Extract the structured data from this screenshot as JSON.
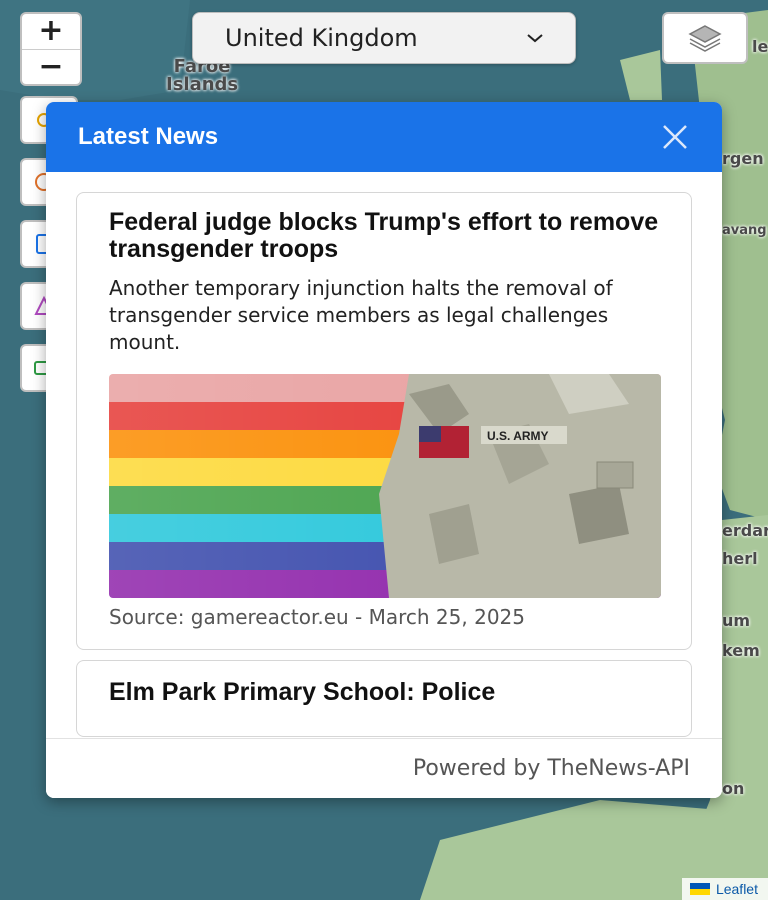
{
  "map": {
    "labels": {
      "faroe": "Faroe\nIslands",
      "edge_1": "les",
      "edge_2": "rgen",
      "edge_3": "avang",
      "edge_4": "erdar",
      "edge_5": "herl",
      "edge_6": "um",
      "edge_7": "kem",
      "edge_8": "on"
    },
    "attribution": "Leaflet"
  },
  "controls": {
    "zoom_in": "+",
    "zoom_out": "−",
    "country_select": {
      "value": "United Kingdom",
      "icon": "chevron-down-icon"
    },
    "layers_icon": "layers-icon"
  },
  "modal": {
    "title": "Latest News",
    "close_icon": "close-icon",
    "articles": [
      {
        "title": "Federal judge blocks Trump's effort to remove transgender troops",
        "description": "Another temporary injunction halts the removal of transgender service members as legal challenges mount.",
        "image_patch": "U.S. ARMY",
        "source": "Source: gamereactor.eu - March 25, 2025"
      },
      {
        "title": "Elm Park Primary School: Police"
      }
    ],
    "footer": "Powered by TheNews-API"
  },
  "colors": {
    "header_blue": "#1a73e8",
    "sea": "#3b6e7c",
    "land": "#a9c79a"
  }
}
